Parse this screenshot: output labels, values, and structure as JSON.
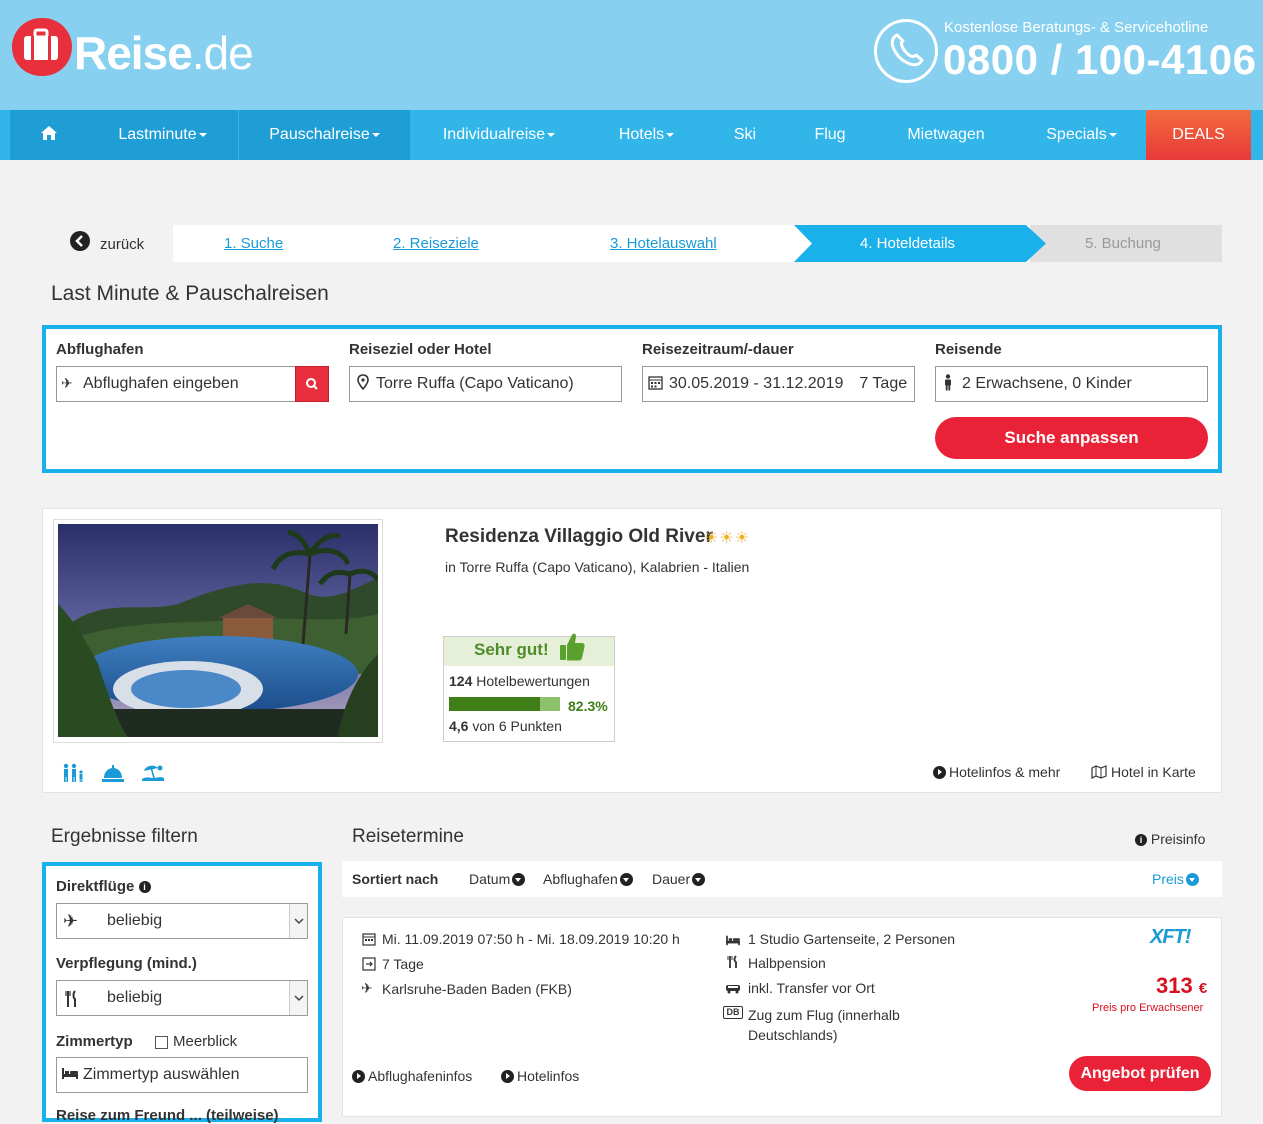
{
  "header": {
    "logo_main": "Reise",
    "logo_tld": ".de",
    "hotline_label": "Kostenlose Beratungs- & Servicehotline",
    "hotline_number": "0800 / 100-4106"
  },
  "nav": {
    "items": [
      {
        "label": "Lastminute"
      },
      {
        "label": "Pauschalreise"
      },
      {
        "label": "Individualreise"
      },
      {
        "label": "Hotels"
      },
      {
        "label": "Ski"
      },
      {
        "label": "Flug"
      },
      {
        "label": "Mietwagen"
      },
      {
        "label": "Specials"
      },
      {
        "label": "DEALS"
      }
    ]
  },
  "steps": {
    "back": "zurück",
    "items": [
      "1. Suche",
      "2. Reiseziele",
      "3. Hotelauswahl",
      "4. Hoteldetails",
      "5. Buchung"
    ]
  },
  "search": {
    "title": "Last Minute & Pauschalreisen",
    "departure_label": "Abflughafen",
    "departure_placeholder": "Abflughafen eingeben",
    "destination_label": "Reiseziel oder Hotel",
    "destination_value": "Torre Ruffa (Capo Vaticano)",
    "period_label": "Reisezeitraum/-dauer",
    "period_dates": "30.05.2019 - 31.12.2019",
    "period_duration": "7 Tage",
    "travellers_label": "Reisende",
    "travellers_value": "2 Erwachsene, 0 Kinder",
    "submit_label": "Suche anpassen"
  },
  "hotel": {
    "name": "Residenza Villaggio Old River",
    "stars": "☀☀☀",
    "location": "in Torre Ruffa (Capo Vaticano), Kalabrien - Italien",
    "rating_word": "Sehr gut!",
    "rating_count": "124",
    "rating_count_label": "Hotelbewertungen",
    "recommend_pct": 82.3,
    "recommend_pct_text": "82.3%",
    "score": "4,6",
    "score_label": "von 6 Punkten",
    "link_infos": "Hotelinfos & mehr",
    "link_map": "Hotel in Karte"
  },
  "filter": {
    "title": "Ergebnisse filtern",
    "direct_label": "Direktflüge",
    "direct_value": "beliebig",
    "board_label": "Verpflegung (mind.)",
    "board_value": "beliebig",
    "room_label": "Zimmertyp",
    "seaview_label": "Meerblick",
    "room_placeholder": "Zimmertyp auswählen",
    "next_label": "Reise zum Freund ... (teilweise)"
  },
  "results": {
    "title": "Reisetermine",
    "priceinfo": "Preisinfo",
    "sort_label": "Sortiert nach",
    "sort_options": [
      "Datum",
      "Abflughafen",
      "Dauer"
    ],
    "sort_active": "Preis",
    "offer": {
      "dates": "Mi. 11.09.2019 07:50 h - Mi. 18.09.2019 10:20 h",
      "duration": "7 Tage",
      "airport": "Karlsruhe-Baden Baden (FKB)",
      "room": "1 Studio Gartenseite, 2 Personen",
      "board": "Halbpension",
      "transfer": "inkl. Transfer vor Ort",
      "train_line1": "Zug zum Flug (innerhalb",
      "train_line2": "Deutschlands)",
      "train_badge": "DB",
      "operator": "XFT!",
      "price": "313",
      "currency": "€",
      "price_note": "Preis pro Erwachsener",
      "link_airport": "Abflughafeninfos",
      "link_hotel": "Hotelinfos",
      "cta": "Angebot prüfen"
    }
  },
  "colors": {
    "header_bg": "#87d0ef",
    "nav_bg": "#32b5e8",
    "accent_red": "#ea2238",
    "accent_blue": "#1ab0ea",
    "rating_green": "#3f7d17"
  }
}
